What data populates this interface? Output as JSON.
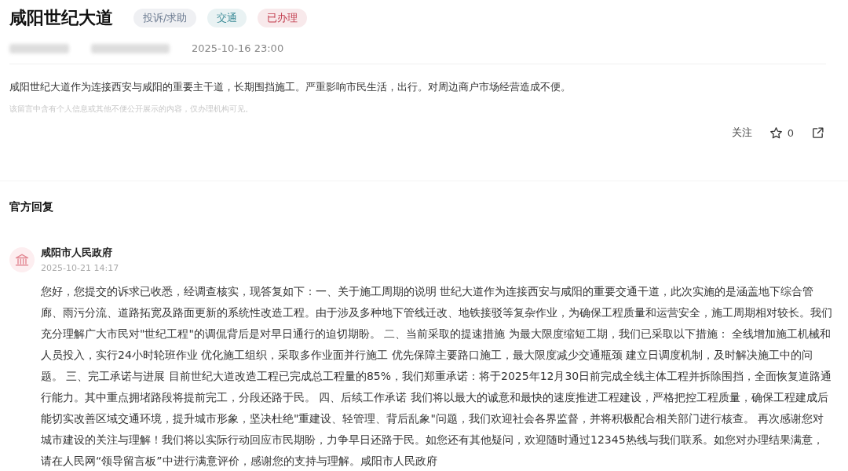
{
  "post": {
    "title": "咸阳世纪大道",
    "tags": [
      {
        "label": "投诉/求助",
        "color": "#6b7a90"
      },
      {
        "label": "交通",
        "color": "#3a8a96"
      },
      {
        "label": "已办理",
        "color": "#c0394b"
      }
    ],
    "date": "2025-10-16 23:00",
    "body": "咸阳世纪大道作为连接西安与咸阳的重要主干道，长期围挡施工。严重影响市民生活，出行。对周边商户市场经营造成不便。",
    "privacy_note": "该留言中含有个人信息或其他不便公开展示的内容，仅办理机构可见。",
    "actions": {
      "follow": "关注",
      "likes": "0"
    }
  },
  "reply": {
    "heading": "官方回复",
    "author": "咸阳市人民政府",
    "date": "2025-10-21 14:17",
    "text": "您好，您提交的诉求已收悉，经调查核实，现答复如下：一、关于施工周期的说明 世纪大道作为连接西安与咸阳的重要交通干道，此次实施的是涵盖地下综合管廊、雨污分流、道路拓宽及路面更新的系统性改造工程。由于涉及多种地下管线迁改、地铁接驳等复杂作业，为确保工程质量和运营安全，施工周期相对较长。我们充分理解广大市民对\"世纪工程\"的调侃背后是对早日通行的迫切期盼。 二、当前采取的提速措施 为最大限度缩短工期，我们已采取以下措施： 全线增加施工机械和人员投入，实行24小时轮班作业 优化施工组织，采取多作业面并行施工 优先保障主要路口施工，最大限度减少交通瓶颈 建立日调度机制，及时解决施工中的问题。 三、完工承诺与进展 目前世纪大道改造工程已完成总工程量的85%，我们郑重承诺：将于2025年12月30日前完成全线主体工程并拆除围挡，全面恢复道路通行能力。其中重点拥堵路段将提前完工，分段还路于民。 四、后续工作承诺 我们将以最大的诚意和最快的速度推进工程建设，严格把控工程质量，确保工程建成后能切实改善区域交通环境，提升城市形象，坚决杜绝\"重建设、轻管理、背后乱象\"问题，我们欢迎社会各界监督，并将积极配合相关部门进行核查。 再次感谢您对城市建设的关注与理解！我们将以实际行动回应市民期盼，力争早日还路于民。如您还有其他疑问，欢迎随时通过12345热线与我们联系。如您对办理结果满意，请在人民网“领导留言板”中进行满意评价，感谢您的支持与理解。咸阳市人民政府"
  }
}
